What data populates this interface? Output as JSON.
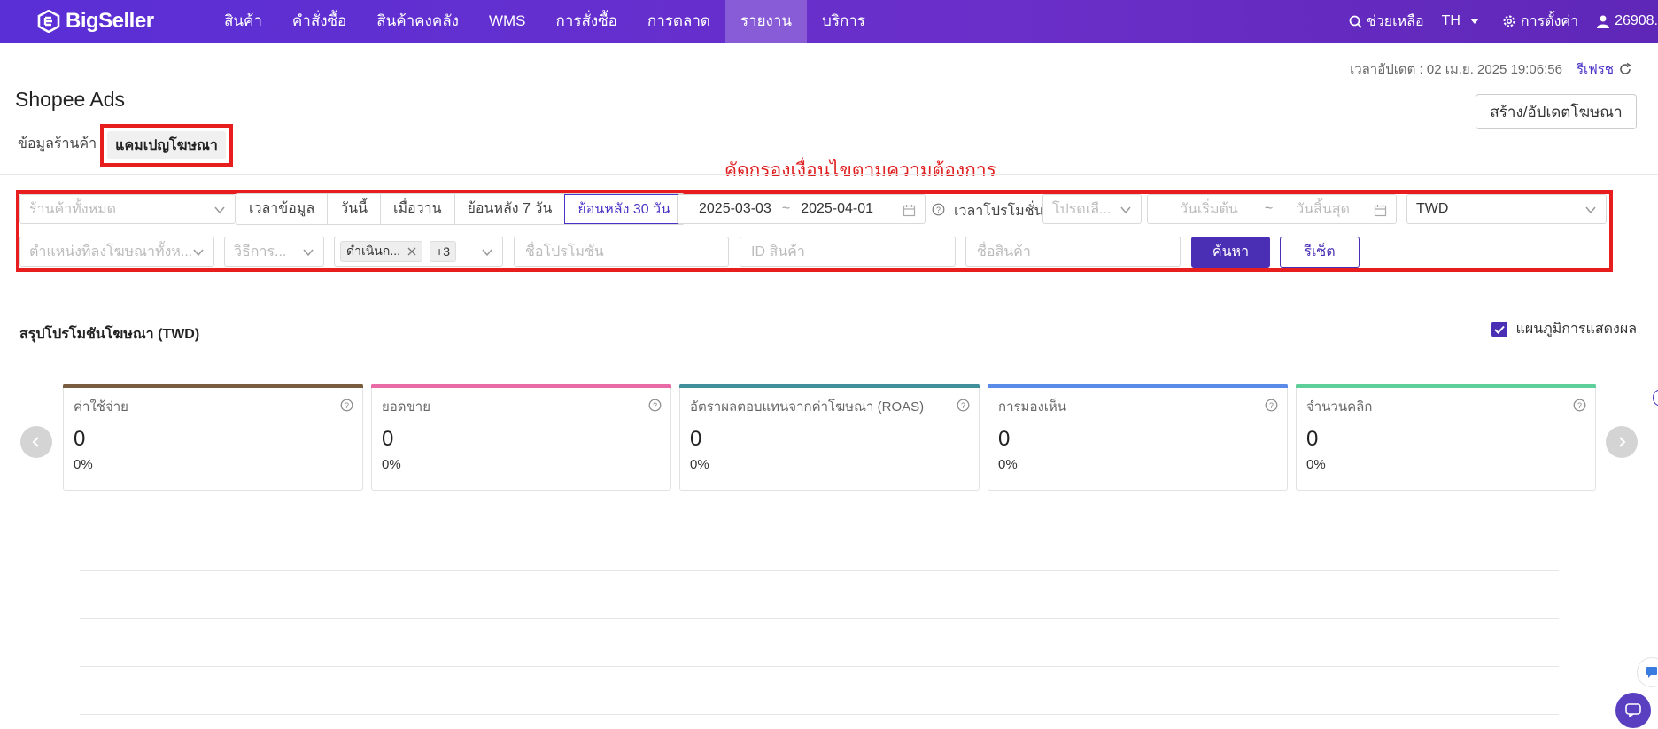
{
  "app": {
    "brand": "BigSeller"
  },
  "nav": {
    "items": [
      {
        "label": "สินค้า"
      },
      {
        "label": "คำสั่งซื้อ"
      },
      {
        "label": "สินค้าคงคลัง"
      },
      {
        "label": "WMS"
      },
      {
        "label": "การสั่งซื้อ"
      },
      {
        "label": "การตลาด"
      },
      {
        "label": "รายงาน",
        "active": true
      },
      {
        "label": "บริการ"
      }
    ]
  },
  "topright": {
    "help": "ช่วยเหลือ",
    "lang": "TH",
    "settings": "การตั้งค่า",
    "user": "26908."
  },
  "update": {
    "label": "เวลาอัปเดต : 02 เม.ย. 2025 19:06:56",
    "refresh": "รีเฟรช"
  },
  "page": {
    "title": "Shopee Ads",
    "create_button": "สร้าง/อัปเดตโฆษณา"
  },
  "tabs": {
    "shop_info": "ข้อมูลร้านค้า",
    "campaign": "แคมเปญโฆษณา"
  },
  "annotation": "คัดกรองเงื่อนไขตามความต้องการ",
  "filters": {
    "shop_placeholder": "ร้านค้าทั้งหมด",
    "data_time_label": "เวลาข้อมูล",
    "range_options": [
      "วันนี้",
      "เมื่อวาน",
      "ย้อนหลัง 7 วัน",
      "ย้อนหลัง 30 วัน"
    ],
    "range_selected": "ย้อนหลัง 30 วัน",
    "date_start": "2025-03-03",
    "date_sep": "~",
    "date_end": "2025-04-01",
    "promo_time_label": "เวลาโปรโมชั่น",
    "promo_select_placeholder": "โปรดเลื...",
    "promo_start_placeholder": "วันเริ่มต้น",
    "promo_end_placeholder": "วันสิ้นสุด",
    "currency": "TWD",
    "placement_placeholder": "ตำแหน่งที่ลงโฆษณาทั้งห...",
    "method_placeholder": "วิธีการ...",
    "status_tag": "ดำเนินก...",
    "status_more": "+3",
    "promo_name_placeholder": "ชื่อโปรโมชัน",
    "product_id_placeholder": "ID สินค้า",
    "product_name_placeholder": "ชื่อสินค้า",
    "search_button": "ค้นหา",
    "reset_button": "รีเซ็ต"
  },
  "summary": {
    "title": "สรุปโปรโมชันโฆษณา (TWD)",
    "chart_toggle": "แผนภูมิการแสดงผล",
    "chart_toggle_checked": true,
    "cards": [
      {
        "label": "ค่าใช้จ่าย",
        "value": "0",
        "pct": "0%",
        "color": "#7a5c3e"
      },
      {
        "label": "ยอดขาย",
        "value": "0",
        "pct": "0%",
        "color": "#e96ba6"
      },
      {
        "label": "อัตราผลตอบแทนจากค่าโฆษณา (ROAS)",
        "value": "0",
        "pct": "0%",
        "color": "#3f8f9c"
      },
      {
        "label": "การมองเห็น",
        "value": "0",
        "pct": "0%",
        "color": "#5b8be8"
      },
      {
        "label": "จำนวนคลิก",
        "value": "0",
        "pct": "0%",
        "color": "#5ecf9a"
      }
    ]
  },
  "colors": {
    "brand": "#5a2fd6",
    "primary": "#4a2fb5",
    "annotation": "#e81e1e"
  }
}
